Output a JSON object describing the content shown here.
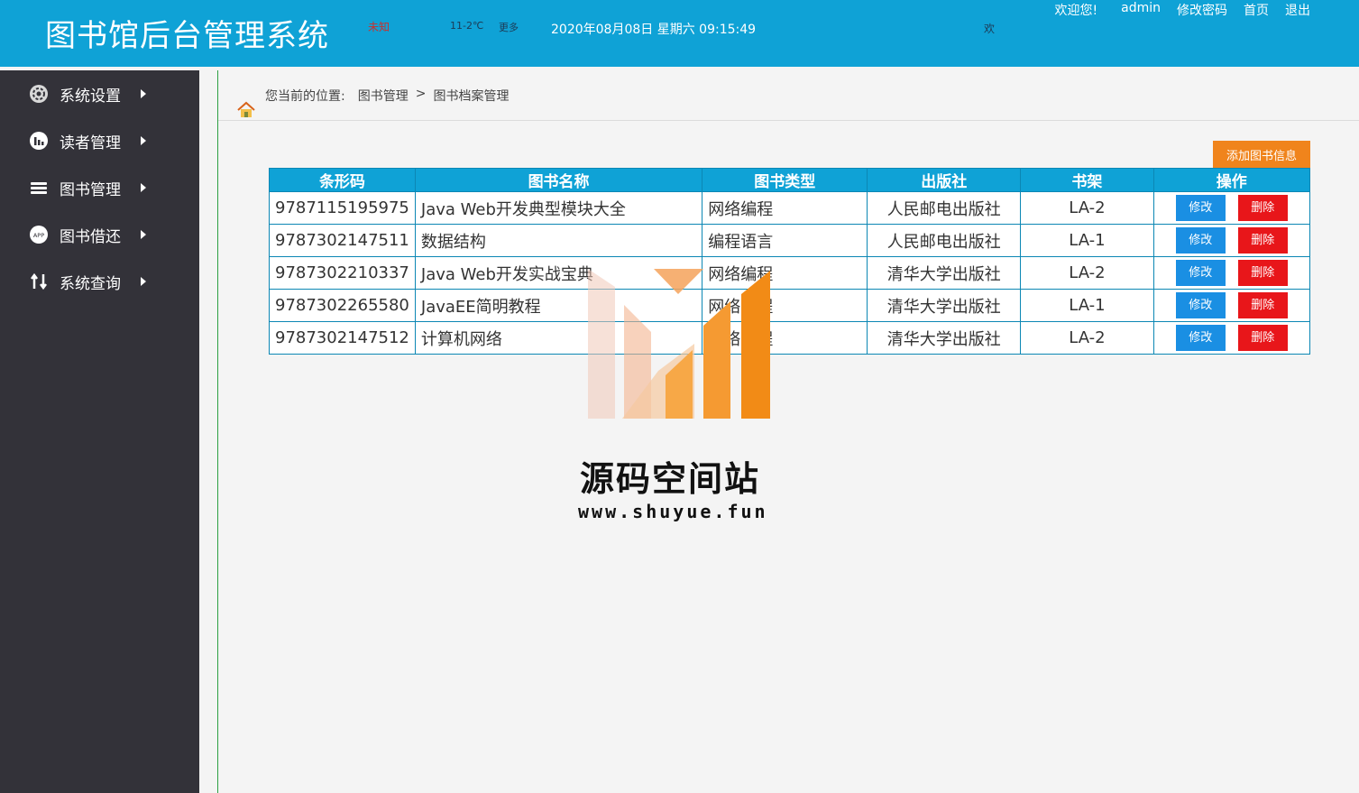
{
  "header": {
    "title": "图书馆后台管理系统",
    "weather_city": "未知",
    "weather_temp": "11-2℃",
    "weather_more": "更多",
    "datetime": "2020年08月08日 星期六 09:15:49",
    "welcome_mark": "欢",
    "welcome": "欢迎您!",
    "user": "admin",
    "change_password": "修改密码",
    "home": "首页",
    "logout": "退出"
  },
  "sidebar": {
    "items": [
      {
        "label": "系统设置",
        "icon": "gear-icon"
      },
      {
        "label": "读者管理",
        "icon": "chart-icon"
      },
      {
        "label": "图书管理",
        "icon": "stack-icon"
      },
      {
        "label": "图书借还",
        "icon": "app-icon"
      },
      {
        "label": "系统查询",
        "icon": "swap-icon"
      }
    ]
  },
  "breadcrumb": {
    "prefix": "您当前的位置:",
    "level1": "图书管理",
    "separator": ">",
    "level2": "图书档案管理"
  },
  "actions": {
    "add_label": "添加图书信息"
  },
  "table": {
    "headers": [
      "条形码",
      "图书名称",
      "图书类型",
      "出版社",
      "书架",
      "操作"
    ],
    "edit_label": "修改",
    "delete_label": "删除",
    "rows": [
      {
        "barcode": "9787115195975",
        "title": "Java Web开发典型模块大全",
        "type": "网络编程",
        "publisher": "人民邮电出版社",
        "shelf": "LA-2"
      },
      {
        "barcode": "9787302147511",
        "title": "数据结构",
        "type": "编程语言",
        "publisher": "人民邮电出版社",
        "shelf": "LA-1"
      },
      {
        "barcode": "9787302210337",
        "title": "Java Web开发实战宝典",
        "type": "网络编程",
        "publisher": "清华大学出版社",
        "shelf": "LA-2"
      },
      {
        "barcode": "9787302265580",
        "title": "JavaEE简明教程",
        "type": "网络编程",
        "publisher": "清华大学出版社",
        "shelf": "LA-1"
      },
      {
        "barcode": "9787302147512",
        "title": "计算机网络",
        "type": "网络编程",
        "publisher": "清华大学出版社",
        "shelf": "LA-2"
      }
    ]
  },
  "watermark": {
    "text": "源码空间站",
    "url": "www.shuyue.fun"
  },
  "colors": {
    "header_bg": "#0fa2d6",
    "sidebar_bg": "#333239",
    "add_button": "#f0841c",
    "edit_button": "#1a8fe3",
    "delete_button": "#e8161a"
  }
}
